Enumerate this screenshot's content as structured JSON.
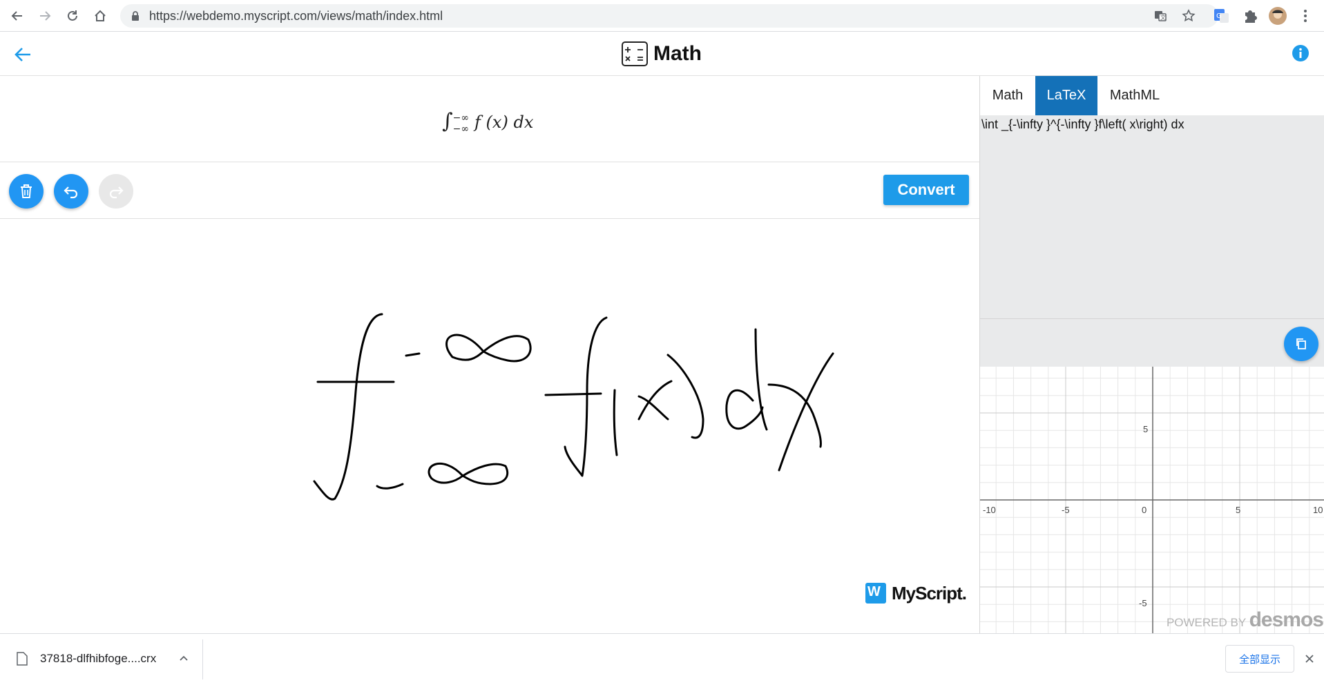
{
  "browser": {
    "url": "https://webdemo.myscript.com/views/math/index.html"
  },
  "app": {
    "title": "Math",
    "accent": "#2196f3"
  },
  "result": {
    "lower_limit": "−∞",
    "upper_limit": "−∞",
    "expression": "f (x) dx"
  },
  "toolbar": {
    "convert_label": "Convert",
    "clear_icon": "trash-icon",
    "undo_icon": "undo-icon",
    "redo_icon": "redo-icon"
  },
  "right_panel": {
    "tabs": [
      {
        "label": "Math",
        "active": false
      },
      {
        "label": "LaTeX",
        "active": true
      },
      {
        "label": "MathML",
        "active": false
      }
    ],
    "latex_output": "\\int _{-\\infty }^{-\\infty }f\\left( x\\right) dx",
    "graph": {
      "x_ticks": [
        "-10",
        "-5",
        "0",
        "5",
        "10"
      ],
      "y_ticks": [
        "5",
        "-5"
      ],
      "credit_prefix": "POWERED BY",
      "credit_brand": "desmos"
    }
  },
  "branding": {
    "logo_text": "MyScript."
  },
  "download_shelf": {
    "file_name": "37818-dlfhibfoge....crx",
    "show_all_label": "全部显示"
  }
}
